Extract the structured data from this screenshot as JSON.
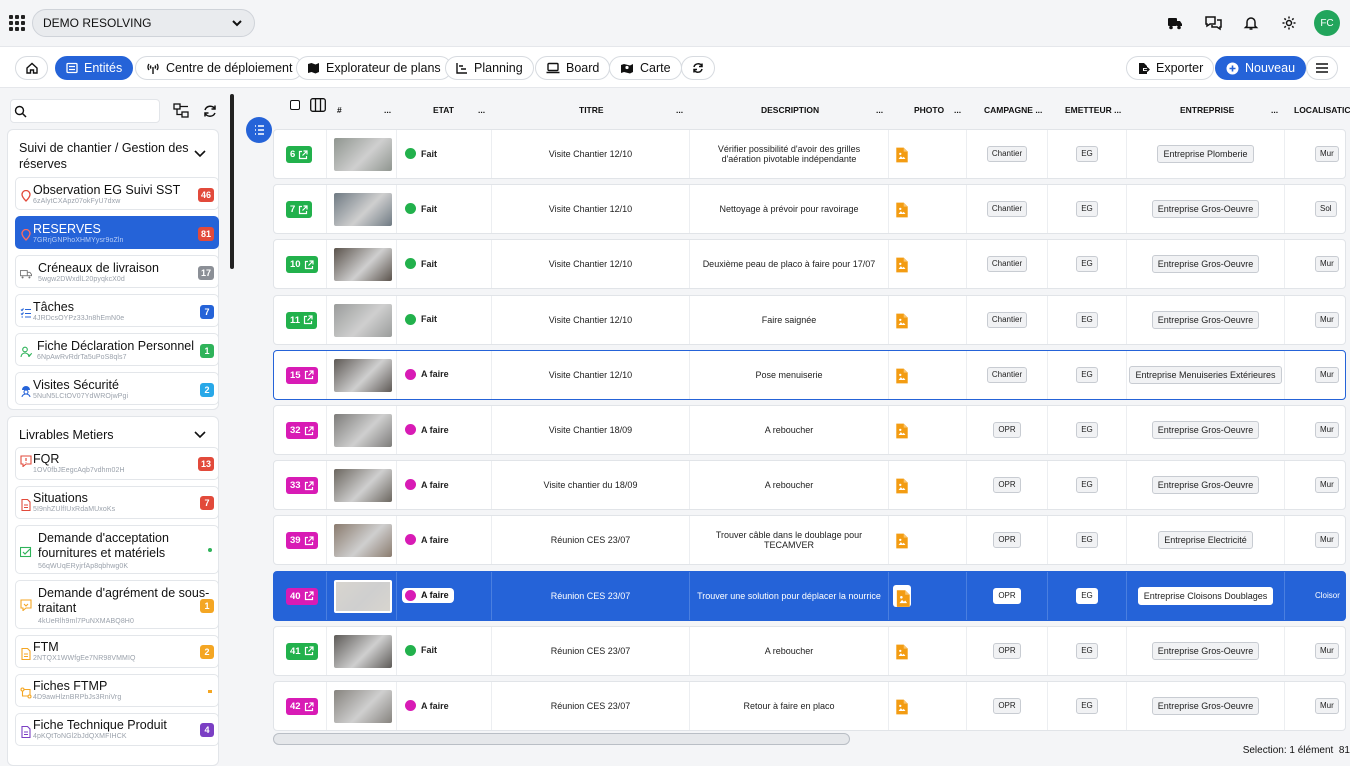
{
  "project": {
    "name": "DEMO RESOLVING"
  },
  "user": {
    "initials": "FC"
  },
  "nav": {
    "tabs": [
      "Entités",
      "Centre de déploiement",
      "Explorateur de plans",
      "Planning",
      "Board",
      "Carte"
    ],
    "export_label": "Exporter",
    "new_label": "Nouveau"
  },
  "sidebar": {
    "groups": [
      {
        "title_line1": "Suivi de chantier / Gestion des",
        "title_line2": "réserves",
        "items": [
          {
            "label": "Observation EG Suivi SST",
            "id": "6zAlytCXApz07okFyU7dxw",
            "count": "46",
            "color": "#e24a3b",
            "icon": "pin-icon"
          },
          {
            "label": "RESERVES",
            "id": "7GRrjGNPhoXHMYysr9oZln",
            "count": "81",
            "color": "#e24a3b",
            "icon": "pin-icon"
          },
          {
            "label": "Créneaux de livraison",
            "id": "5wgw2DWxdlL20pyqkcX0d",
            "count": "17",
            "color": "#8b8f96",
            "icon": "truck-icon"
          },
          {
            "label": "Tâches",
            "id": "4JRDcsOYPz33Jn8hEmN0e",
            "count": "7",
            "color": "#2563d8",
            "icon": "tasks-icon"
          },
          {
            "label": "Fiche Déclaration Personnel",
            "id": "6NpAwRvRdrTa5uPoS8qls7",
            "count": "1",
            "color": "#2fb35a",
            "icon": "person-icon"
          },
          {
            "label": "Visites Sécurité",
            "id": "5NuN5LCtOV07YdWROjwPgi",
            "count": "2",
            "color": "#28a8e8",
            "icon": "worker-icon"
          }
        ]
      },
      {
        "title_line1": "Livrables Metiers",
        "items": [
          {
            "label": "FQR",
            "id": "1OV0fbJEegcAqb7vdhm02H",
            "count": "13",
            "color": "#e24a3b",
            "icon": "report-icon"
          },
          {
            "label": "Situations",
            "id": "5I9nhZUlfIUxRdaMUxoKs",
            "count": "7",
            "color": "#e24a3b",
            "icon": "doc-icon"
          },
          {
            "label_line1": "Demande d'acceptation",
            "label_line2": "fournitures et matériels",
            "id": "56qWUqERyjrfAp8qbhwg0K",
            "count": "",
            "color": "#2fb35a",
            "icon": "check-doc-icon"
          },
          {
            "label_line1": "Demande d'agrément de sous-",
            "label_line2": "traitant",
            "id": "4kUeRlh9ml7PuNXMABQ8H0",
            "count": "1",
            "color": "#f4a623",
            "icon": "comment-icon"
          },
          {
            "label": "FTM",
            "id": "2NTQX1WWfgEe7NR98VMMIQ",
            "count": "2",
            "color": "#f4a623",
            "icon": "doc-icon"
          },
          {
            "label": "Fiches FTMP",
            "id": "4D9awHlznBRPbJs3RniVrg",
            "count": "",
            "color": "#f4a623",
            "icon": "flow-icon"
          },
          {
            "label": "Fiche Technique Produit",
            "id": "4pKQtToNGl2bJdQXMFIHCK",
            "count": "4",
            "color": "#7b3fc4",
            "icon": "doc-icon"
          }
        ]
      }
    ]
  },
  "table": {
    "headers": {
      "num": "#",
      "etat": "ETAT",
      "titre": "TITRE",
      "description": "DESCRIPTION",
      "photo": "PHOTO",
      "campagne": "CAMPAGNE ...",
      "emetteur": "EMETTEUR ...",
      "entreprise": "ENTREPRISE",
      "localisation": "LOCALISATIC",
      "dots": "..."
    },
    "rows": [
      {
        "num": "6",
        "etat": "Fait",
        "titre": "Visite Chantier 12/10",
        "desc1": "Vérifier possibilité d'avoir des grilles",
        "desc2": "d'aération pivotable indépendante",
        "campagne": "Chantier",
        "emetteur": "EG",
        "entreprise": "Entreprise Plomberie",
        "loc": "Mur"
      },
      {
        "num": "7",
        "etat": "Fait",
        "titre": "Visite Chantier 12/10",
        "desc1": "Nettoyage à prévoir pour ravoirage",
        "desc2": "",
        "campagne": "Chantier",
        "emetteur": "EG",
        "entreprise": "Entreprise Gros-Oeuvre",
        "loc": "Sol"
      },
      {
        "num": "10",
        "etat": "Fait",
        "titre": "Visite Chantier 12/10",
        "desc1": "Deuxième peau de placo à faire pour 17/07",
        "desc2": "",
        "campagne": "Chantier",
        "emetteur": "EG",
        "entreprise": "Entreprise Gros-Oeuvre",
        "loc": "Mur"
      },
      {
        "num": "11",
        "etat": "Fait",
        "titre": "Visite Chantier 12/10",
        "desc1": "Faire saignée",
        "desc2": "",
        "campagne": "Chantier",
        "emetteur": "EG",
        "entreprise": "Entreprise Gros-Oeuvre",
        "loc": "Mur"
      },
      {
        "num": "15",
        "etat": "A faire",
        "titre": "Visite Chantier 12/10",
        "desc1": "Pose menuiserie",
        "desc2": "",
        "campagne": "Chantier",
        "emetteur": "EG",
        "entreprise": "Entreprise Menuiseries Extérieures",
        "loc": "Mur"
      },
      {
        "num": "32",
        "etat": "A faire",
        "titre": "Visite Chantier 18/09",
        "desc1": "A reboucher",
        "desc2": "",
        "campagne": "OPR",
        "emetteur": "EG",
        "entreprise": "Entreprise Gros-Oeuvre",
        "loc": "Mur"
      },
      {
        "num": "33",
        "etat": "A faire",
        "titre": "Visite chantier du 18/09",
        "desc1": "A reboucher",
        "desc2": "",
        "campagne": "OPR",
        "emetteur": "EG",
        "entreprise": "Entreprise Gros-Oeuvre",
        "loc": "Mur"
      },
      {
        "num": "39",
        "etat": "A faire",
        "titre": "Réunion CES 23/07",
        "desc1": "Trouver câble dans le doublage pour",
        "desc2": "TECAMVER",
        "campagne": "OPR",
        "emetteur": "EG",
        "entreprise": "Entreprise Electricité",
        "loc": "Mur"
      },
      {
        "num": "40",
        "etat": "A faire",
        "titre": "Réunion CES 23/07",
        "desc1": "Trouver une solution pour déplacer la nourrice",
        "desc2": "",
        "campagne": "OPR",
        "emetteur": "EG",
        "entreprise": "Entreprise Cloisons Doublages",
        "loc": "Cloisor"
      },
      {
        "num": "41",
        "etat": "Fait",
        "titre": "Réunion CES 23/07",
        "desc1": "A reboucher",
        "desc2": "",
        "campagne": "OPR",
        "emetteur": "EG",
        "entreprise": "Entreprise Gros-Oeuvre",
        "loc": "Mur"
      },
      {
        "num": "42",
        "etat": "A faire",
        "titre": "Réunion CES 23/07",
        "desc1": "Retour à faire en placo",
        "desc2": "",
        "campagne": "OPR",
        "emetteur": "EG",
        "entreprise": "Entreprise Gros-Oeuvre",
        "loc": "Mur"
      }
    ]
  },
  "colors": {
    "accent": "#2563d8",
    "done": "#22b14c",
    "todo": "#d81bb5",
    "doc": "#f39c12"
  },
  "status": {
    "selection": "Selection: 1 élément",
    "total": "81"
  }
}
